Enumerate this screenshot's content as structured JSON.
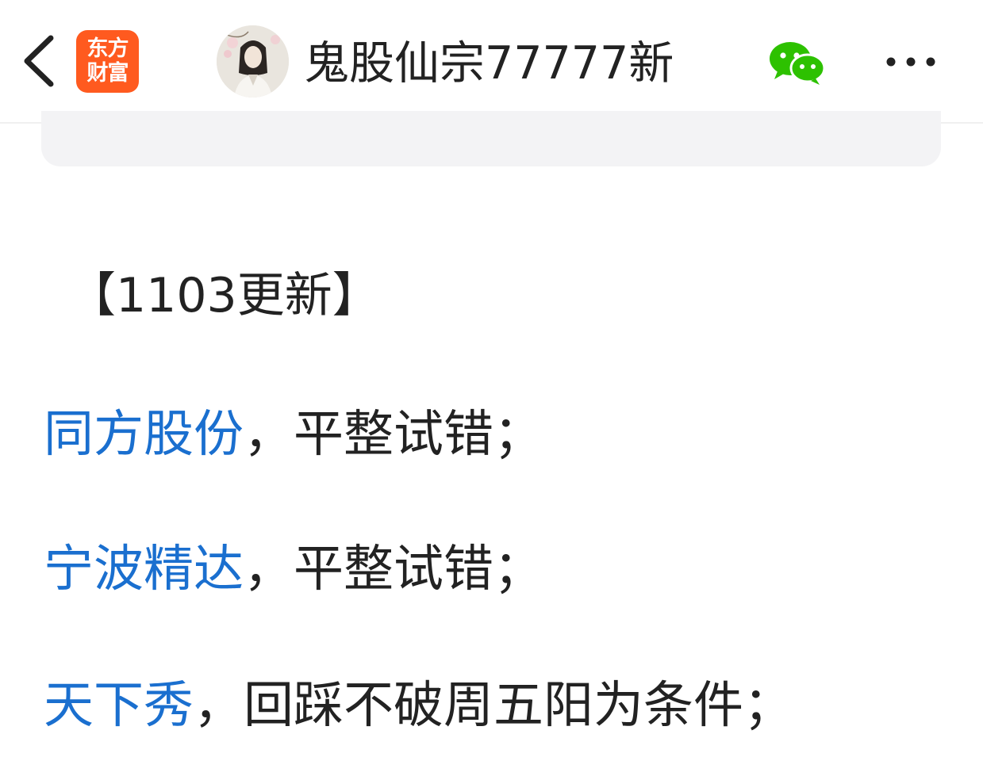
{
  "header": {
    "logo": {
      "line1": "东方",
      "line2": "财富"
    },
    "author_name": "鬼股仙宗77777新"
  },
  "icons": {
    "back": "chevron-left-icon",
    "share": "wechat-icon",
    "more": "more-dots-icon"
  },
  "colors": {
    "brand": "#ff5a1f",
    "link": "#1a6fcf",
    "wechat": "#2dc100",
    "text": "#222222"
  },
  "article": {
    "title": "【1103更新】",
    "items": [
      {
        "stock": "同方股份",
        "note": "，平整试错；"
      },
      {
        "stock": "宁波精达",
        "note": "，平整试错；"
      },
      {
        "stock": "天下秀",
        "note": "，回踩不破周五阳为条件；"
      }
    ]
  }
}
